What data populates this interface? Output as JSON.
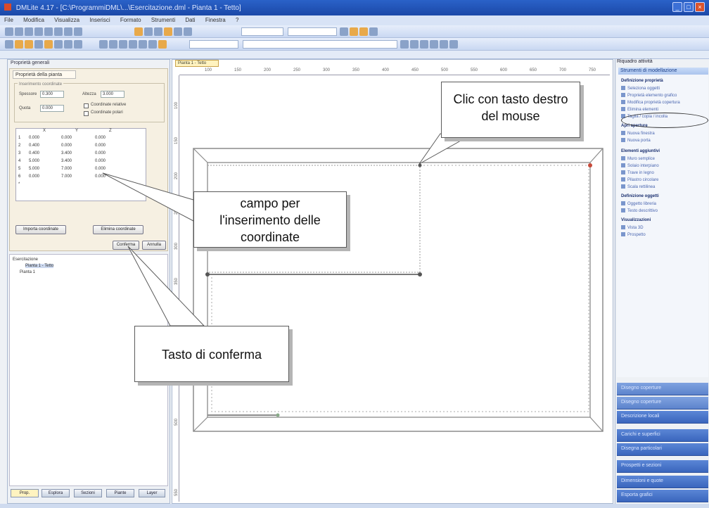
{
  "window": {
    "title": "DMLite 4.17 - [C:\\ProgrammiDML\\...\\Esercitazione.dml - Pianta 1 - Tetto]"
  },
  "menubar": {
    "items": [
      "File",
      "Modifica",
      "Visualizza",
      "Inserisci",
      "Formato",
      "Strumenti",
      "Dati",
      "Finestra",
      "?"
    ]
  },
  "left_panel": {
    "title": "Proprietà generali",
    "props_tab": "Proprietà della pianta",
    "group_label": "Inserimento coordinate",
    "labels": {
      "spessore": "Spessore",
      "altezza": "Altezza",
      "quota": "Quota"
    },
    "inputs": {
      "spessore": "0.300",
      "altezza": "3.000",
      "quota": "0.000"
    },
    "checks": {
      "c1": "Coordinate relative",
      "c2": "Coordinate polari"
    },
    "grid_headers": [
      "X",
      "Y",
      "Z"
    ],
    "grid_rows": [
      {
        "n": "1",
        "x": "0.000",
        "y": "0.000",
        "z": "0.000"
      },
      {
        "n": "2",
        "x": "0.400",
        "y": "0.000",
        "z": "0.000"
      },
      {
        "n": "3",
        "x": "0.400",
        "y": "3.400",
        "z": "0.000"
      },
      {
        "n": "4",
        "x": "5.000",
        "y": "3.400",
        "z": "0.000"
      },
      {
        "n": "5",
        "x": "5.000",
        "y": "7.000",
        "z": "0.000"
      },
      {
        "n": "6",
        "x": "0.000",
        "y": "7.000",
        "z": "0.000"
      },
      {
        "n": "*",
        "x": "",
        "y": "",
        "z": ""
      }
    ],
    "btn_import": "Importa coordinate",
    "btn_delete": "Elimina coordinate",
    "btn_ok": "Conferma",
    "btn_cancel": "Annulla",
    "tree": [
      "Esercitazione",
      "Pianta 1 - Tetto",
      "Pianta 1"
    ],
    "bottom_tabs": [
      "Prop.",
      "Esplora",
      "Sezioni",
      "Piante",
      "Layer"
    ]
  },
  "canvas": {
    "doc_tab": "Pianta 1 - Tetto",
    "ruler_top": [
      "100",
      "150",
      "200",
      "250",
      "300",
      "350",
      "400",
      "450",
      "500",
      "550",
      "600",
      "650",
      "700",
      "750"
    ],
    "ruler_left": [
      "100",
      "150",
      "200",
      "250",
      "300",
      "350",
      "400",
      "450",
      "500",
      "550"
    ]
  },
  "right_panel": {
    "title": "Riquadro attività",
    "band": "Strumenti di modellazione",
    "sections": [
      {
        "title": "Definizione proprietà",
        "items": [
          "Seleziona oggetti",
          "Proprietà elemento grafico",
          "Modifica proprietà copertura",
          "Elimina elementi",
          "Taglia / copia / incolla"
        ]
      },
      {
        "title": "Apri aperture",
        "items": [
          "Nuova finestra",
          "Nuova porta"
        ]
      },
      {
        "title": "Elementi aggiuntivi",
        "items": [
          "Muro semplice",
          "Solaio interpiano",
          "Trave in legno",
          "Pilastro circolare",
          "Scala rettilinea"
        ]
      },
      {
        "title": "Definizione oggetti",
        "items": [
          "Oggetto libreria",
          "Testo descrittivo"
        ]
      },
      {
        "title": "Visualizzazioni",
        "items": [
          "Vista 3D",
          "Prospetto"
        ]
      }
    ],
    "bottom_buttons": [
      "Disegno coperture",
      "Disegno coperture",
      "Descrizione locali",
      "Carichi e superfici",
      "Disegna particolari",
      "Prospetti e sezioni",
      "Dimensioni e quote",
      "Esporta grafici"
    ]
  },
  "callouts": {
    "mouse": [
      "Clic con tasto destro",
      "del mouse"
    ],
    "field": [
      "campo per",
      "l'inserimento delle",
      "coordinate"
    ],
    "tasto": "Tasto di conferma"
  }
}
